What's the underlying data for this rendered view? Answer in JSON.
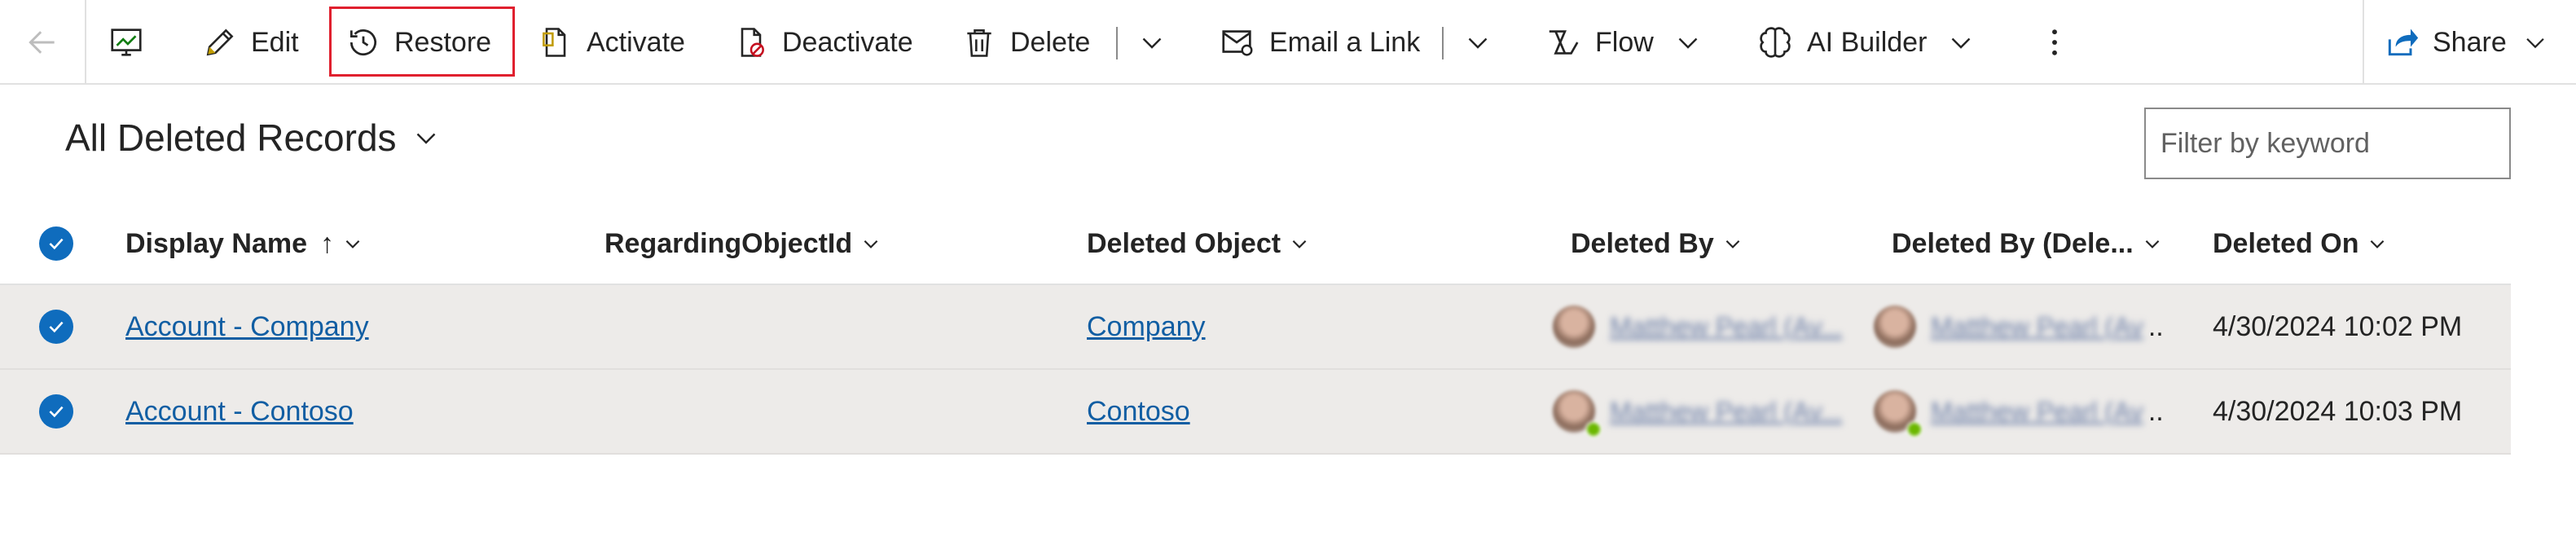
{
  "toolbar": {
    "edit": "Edit",
    "restore": "Restore",
    "activate": "Activate",
    "deactivate": "Deactivate",
    "delete": "Delete",
    "email_link": "Email a Link",
    "flow": "Flow",
    "ai_builder": "AI Builder",
    "share": "Share",
    "icons": [
      "back-arrow-icon",
      "chart-icon",
      "pencil-icon",
      "history-icon",
      "document-icon",
      "document-blocked-icon",
      "trash-icon",
      "chevron-down-icon",
      "email-link-icon",
      "flow-icon",
      "brain-icon",
      "more-vertical-icon",
      "share-icon"
    ]
  },
  "view": {
    "title": "All Deleted Records",
    "filter_placeholder": "Filter by keyword"
  },
  "columns": {
    "display_name": "Display Name",
    "regarding": "RegardingObjectId",
    "deleted_object": "Deleted Object",
    "deleted_by": "Deleted By",
    "deleted_by_delegate": "Deleted By (Dele...",
    "deleted_on": "Deleted On",
    "sort_indicator": "↑"
  },
  "rows": [
    {
      "display_name": "Account - Company",
      "regarding": "",
      "deleted_object": "Company",
      "deleted_by": "Matthew Pearl (Av...",
      "deleted_by_delegate": "Matthew Pearl (Av",
      "ellipsis": "..",
      "deleted_on": "4/30/2024 10:02 PM"
    },
    {
      "display_name": "Account - Contoso",
      "regarding": "",
      "deleted_object": "Contoso",
      "deleted_by": "Matthew Pearl (Av...",
      "deleted_by_delegate": "Matthew Pearl (Av",
      "ellipsis": "..",
      "deleted_on": "4/30/2024 10:03 PM"
    }
  ],
  "colors": {
    "accent": "#0f6cbd",
    "link": "#115ea3",
    "selected_row": "#edebe9",
    "highlight": "#e0202e",
    "presence": "#6bb700"
  }
}
